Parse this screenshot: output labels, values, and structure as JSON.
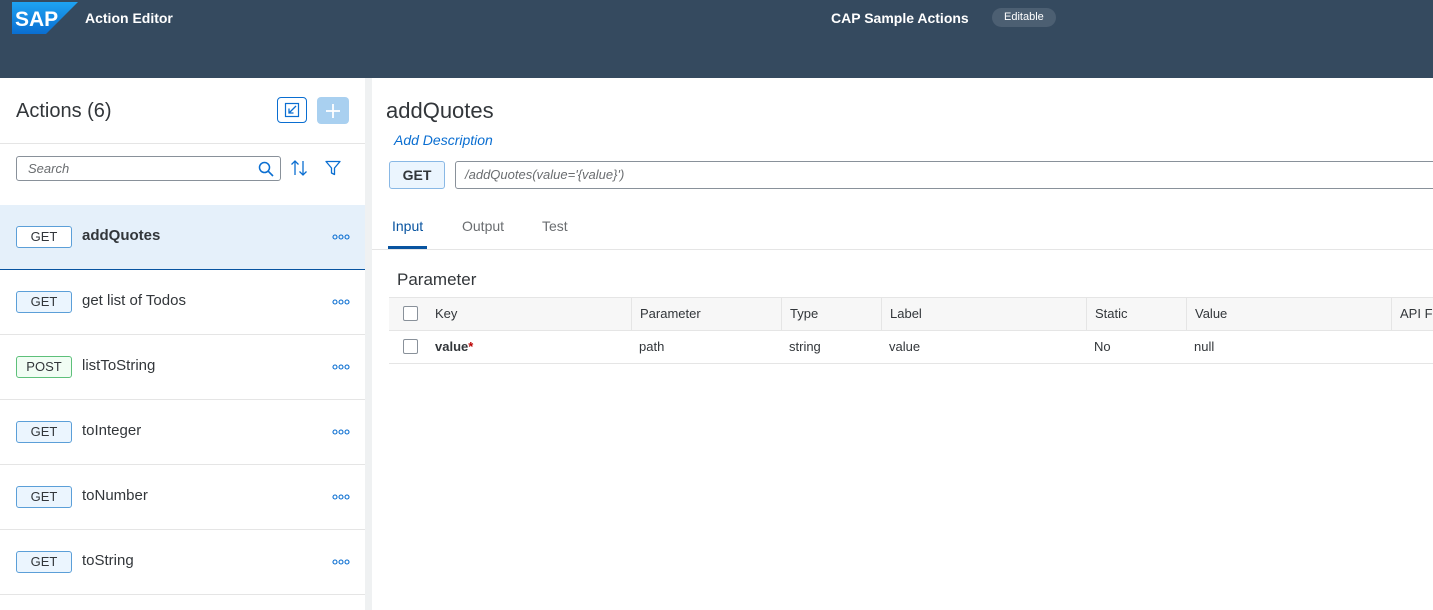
{
  "shell": {
    "logo_text": "SAP",
    "app_title": "Action Editor",
    "center_title": "CAP Sample Actions",
    "badge": "Editable"
  },
  "left_panel": {
    "title": "Actions (6)",
    "search_placeholder": "Search",
    "items": [
      {
        "method": "GET",
        "label": "addQuotes",
        "selected": true
      },
      {
        "method": "GET",
        "label": "get list of Todos",
        "selected": false
      },
      {
        "method": "POST",
        "label": "listToString",
        "selected": false
      },
      {
        "method": "GET",
        "label": "toInteger",
        "selected": false
      },
      {
        "method": "GET",
        "label": "toNumber",
        "selected": false
      },
      {
        "method": "GET",
        "label": "toString",
        "selected": false
      }
    ]
  },
  "detail": {
    "title": "addQuotes",
    "add_description": "Add Description",
    "method": "GET",
    "path": "/addQuotes(value='{value}')",
    "tabs": [
      {
        "label": "Input",
        "active": true
      },
      {
        "label": "Output",
        "active": false
      },
      {
        "label": "Test",
        "active": false
      }
    ],
    "parameter_title": "Parameter",
    "table": {
      "columns": [
        "Key",
        "Parameter",
        "Type",
        "Label",
        "Static",
        "Value",
        "API F"
      ],
      "rows": [
        {
          "key": "value",
          "required_mark": "*",
          "parameter": "path",
          "type": "string",
          "label": "value",
          "static": "No",
          "value": "null"
        }
      ]
    }
  },
  "colors": {
    "shell": "#354a5f",
    "accent": "#0a6ed1",
    "selected_row": "#e5f0fa"
  }
}
